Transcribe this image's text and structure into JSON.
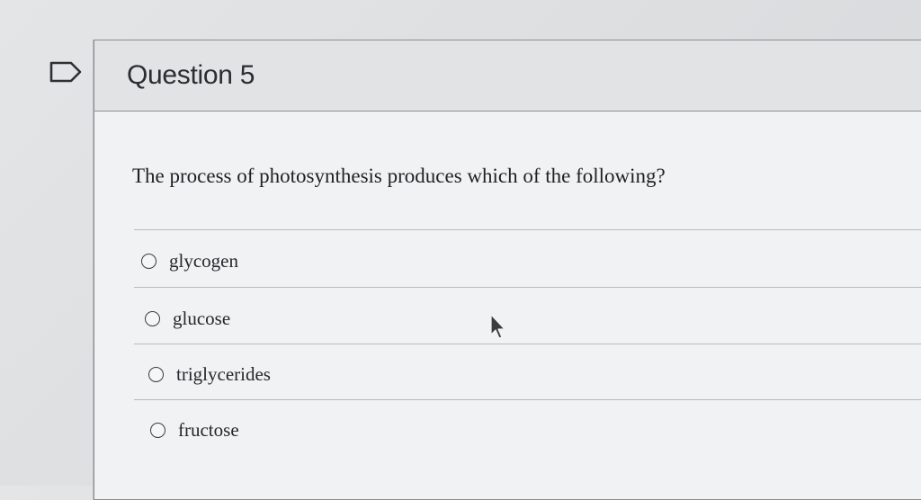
{
  "question": {
    "title": "Question 5",
    "text": "The process of photosynthesis produces which of the following?"
  },
  "answers": [
    {
      "label": "glycogen"
    },
    {
      "label": "glucose"
    },
    {
      "label": "triglycerides"
    },
    {
      "label": "fructose"
    }
  ],
  "icons": {
    "flag": "flag-question-icon",
    "cursor": "mouse-pointer-icon"
  }
}
